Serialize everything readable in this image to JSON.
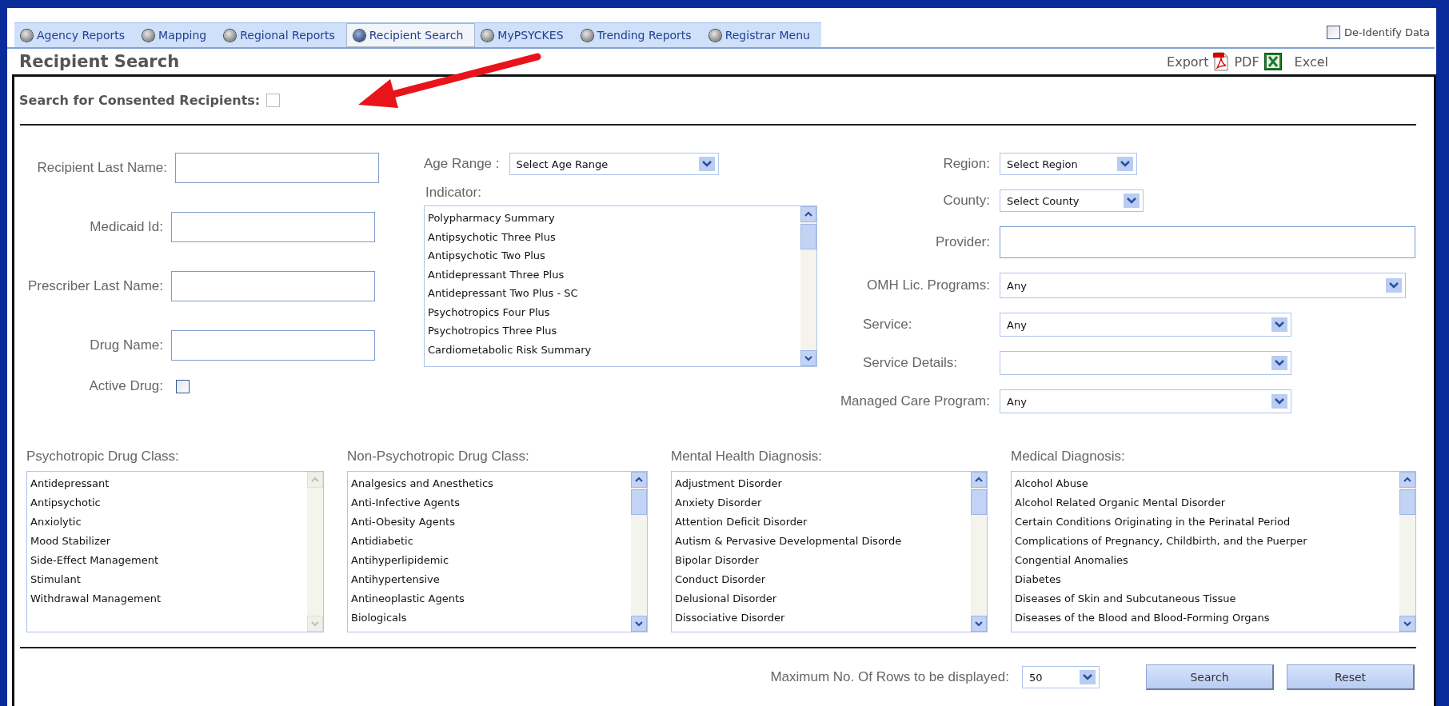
{
  "nav_tabs": [
    {
      "label": "Agency Reports",
      "selected": false
    },
    {
      "label": "Mapping",
      "selected": false
    },
    {
      "label": "Regional Reports",
      "selected": false
    },
    {
      "label": "Recipient Search",
      "selected": true
    },
    {
      "label": "MyPSYCKES",
      "selected": false
    },
    {
      "label": "Trending Reports",
      "selected": false
    },
    {
      "label": "Registrar Menu",
      "selected": false
    }
  ],
  "deidentify": {
    "label": "De-Identify Data",
    "checked": false
  },
  "page_title": "Recipient Search",
  "export": {
    "label": "Export",
    "pdf": "PDF",
    "excel": "Excel"
  },
  "consented": {
    "label": "Search for Consented Recipients:",
    "checked": false
  },
  "left_fields": [
    {
      "kind": "text",
      "label": "Recipient Last Name:"
    },
    {
      "kind": "text",
      "label": "Medicaid Id:"
    },
    {
      "kind": "text",
      "label": "Prescriber Last Name:"
    },
    {
      "kind": "text",
      "label": "Drug Name:"
    },
    {
      "kind": "checkbox",
      "label": "Active Drug:",
      "checked": false
    }
  ],
  "age_range": {
    "label": "Age Range :",
    "value": "Select Age Range"
  },
  "indicator": {
    "label": "Indicator:",
    "scrollbar_disabled": false,
    "options": [
      "Polypharmacy Summary",
      "Antipsychotic Three Plus",
      "Antipsychotic Two Plus",
      "Antidepressant Three Plus",
      "Antidepressant Two Plus - SC",
      "Psychotropics Four Plus",
      "Psychotropics Three Plus",
      "Cardiometabolic Risk Summary"
    ]
  },
  "right_fields": [
    {
      "kind": "select",
      "label": "Region:",
      "value": "Select Region"
    },
    {
      "kind": "select",
      "label": "County:",
      "value": "Select County"
    },
    {
      "kind": "text",
      "label": "Provider:"
    },
    {
      "kind": "select",
      "label": "OMH Lic. Programs:",
      "value": "Any"
    },
    {
      "kind": "select",
      "label": "Service:",
      "value": "Any"
    },
    {
      "kind": "select",
      "label": "Service Details:"
    },
    {
      "kind": "select",
      "label": "Managed Care Program:",
      "value": "Any"
    }
  ],
  "class_lists": [
    {
      "label": "Psychotropic Drug Class:",
      "scrollbar_disabled": true,
      "options": [
        "Antidepressant",
        "Antipsychotic",
        "Anxiolytic",
        "Mood Stabilizer",
        "Side-Effect Management",
        "Stimulant",
        "Withdrawal Management"
      ]
    },
    {
      "label": "Non-Psychotropic Drug Class:",
      "scrollbar_disabled": false,
      "options": [
        "Analgesics and Anesthetics",
        "Anti-Infective Agents",
        "Anti-Obesity Agents",
        "Antidiabetic",
        "Antihyperlipidemic",
        "Antihypertensive",
        "Antineoplastic Agents",
        "Biologicals"
      ]
    },
    {
      "label": "Mental Health Diagnosis:",
      "scrollbar_disabled": false,
      "options": [
        "Adjustment Disorder",
        "Anxiety Disorder",
        "Attention Deficit Disorder",
        "Autism & Pervasive Developmental Disorde",
        "Bipolar Disorder",
        "Conduct Disorder",
        "Delusional Disorder",
        "Dissociative Disorder"
      ]
    },
    {
      "label": "Medical Diagnosis:",
      "scrollbar_disabled": false,
      "options": [
        "Alcohol Abuse",
        "Alcohol Related Organic Mental Disorder",
        "Certain Conditions Originating in the Perinatal Period",
        "Complications of Pregnancy, Childbirth, and the Puerper",
        "Congential Anomalies",
        "Diabetes",
        "Diseases of Skin and Subcutaneous Tissue",
        "Diseases of the Blood and Blood-Forming Organs"
      ]
    }
  ],
  "max_rows": {
    "label": "Maximum No. Of Rows to be displayed:",
    "value": "50"
  },
  "buttons": [
    "Search",
    "Reset"
  ]
}
